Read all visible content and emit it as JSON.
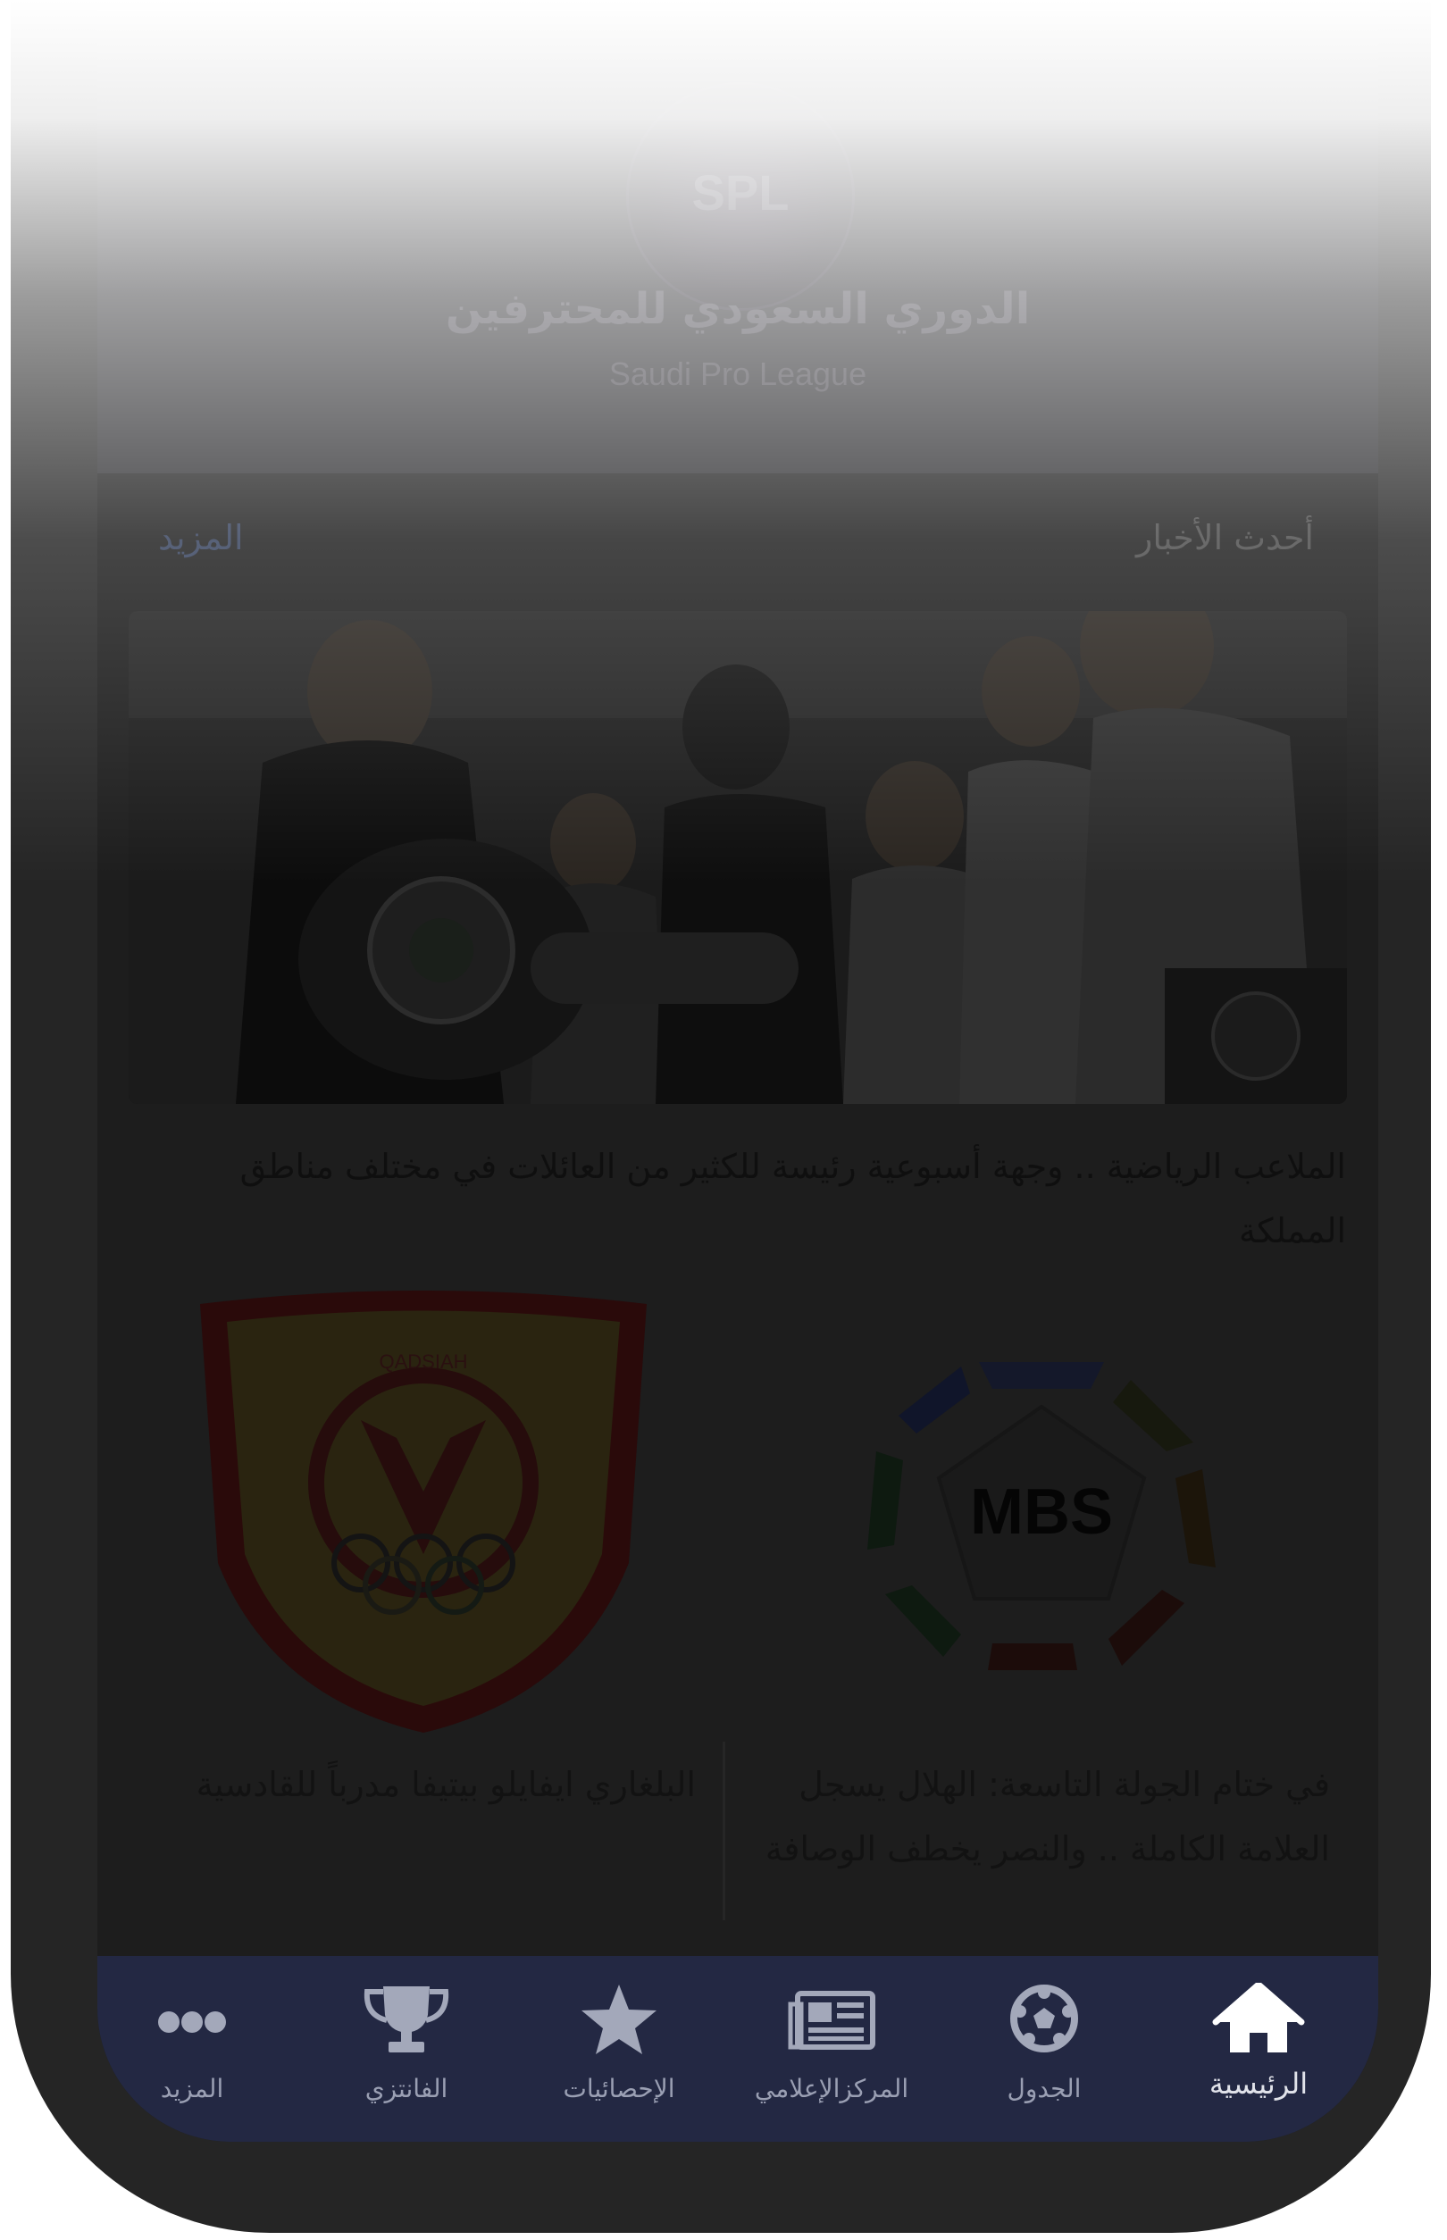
{
  "header": {
    "logo_text": "SPL",
    "league_name_ar": "الدوري السعودي للمحترفين",
    "league_name_en": "Saudi Pro League"
  },
  "news": {
    "section_title": "أحدث الأخبار",
    "more_label": "المزيد",
    "featured": {
      "title": "الملاعب الرياضية .. وجهة أسبوعية رئيسة للكثير من العائلات في مختلف مناطق المملكة"
    },
    "cards": [
      {
        "title": "في ختام الجولة التاسعة: الهلال يسجل العلامة الكاملة .. والنصر يخطف الوصافة",
        "logo_text": "MBS"
      },
      {
        "title": "البلغاري ايفايلو بيتيفا مدرباً للقادسية",
        "logo_text": "QADSIAH"
      }
    ]
  },
  "bottom_nav": {
    "items": [
      {
        "label": "الرئيسية",
        "icon": "home-icon"
      },
      {
        "label": "الجدول",
        "icon": "soccer-ball-icon"
      },
      {
        "label": "المركزالإعلامي",
        "icon": "newspaper-icon"
      },
      {
        "label": "الإحصائيات",
        "icon": "star-icon"
      },
      {
        "label": "الفانتزي",
        "icon": "trophy-icon"
      },
      {
        "label": "المزيد",
        "icon": "more-dots-icon"
      }
    ],
    "active_index": 0
  },
  "colors": {
    "nav_background": "#232843",
    "screen_background": "#1d1d1d",
    "accent_more": "#34405c"
  }
}
